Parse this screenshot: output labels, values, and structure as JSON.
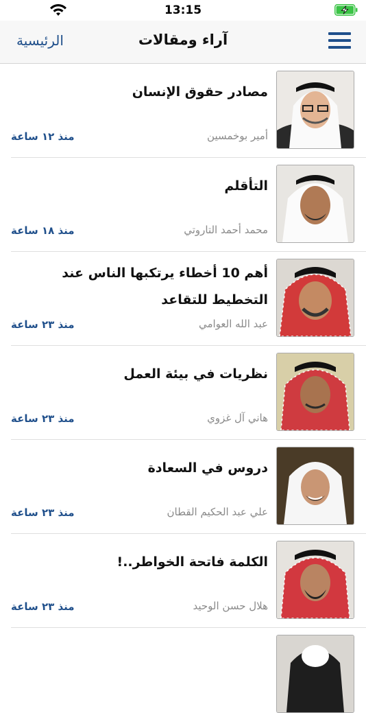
{
  "status": {
    "time": "13:15"
  },
  "nav": {
    "title": "آراء ومقالات",
    "home_label": "الرئيسية"
  },
  "articles": [
    {
      "title": "مصادر حقوق الإنسان",
      "author": "أمير بوخمسين",
      "time": "منذ ١٢ ساعة"
    },
    {
      "title": "التأقلم",
      "author": "محمد أحمد التاروتي",
      "time": "منذ ١٨ ساعة"
    },
    {
      "title": "أهم 10 أخطاء يرتكبها الناس عند التخطيط للتقاعد",
      "author": "عبد الله العوامي",
      "time": "منذ ٢٣ ساعة"
    },
    {
      "title": "نظريات في بيئة العمل",
      "author": "هاني آل غزوي",
      "time": "منذ ٢٣ ساعة"
    },
    {
      "title": "دروس في السعادة",
      "author": "علي عبد الحكيم القطان",
      "time": "منذ ٢٣ ساعة"
    },
    {
      "title": "الكلمة فاتحة الخواطر..!",
      "author": "هلال حسن الوحيد",
      "time": "منذ ٢٣ ساعة"
    }
  ],
  "colors": {
    "accent": "#1f4f8b",
    "muted": "#8a8a8a",
    "battery": "#3cc447"
  }
}
